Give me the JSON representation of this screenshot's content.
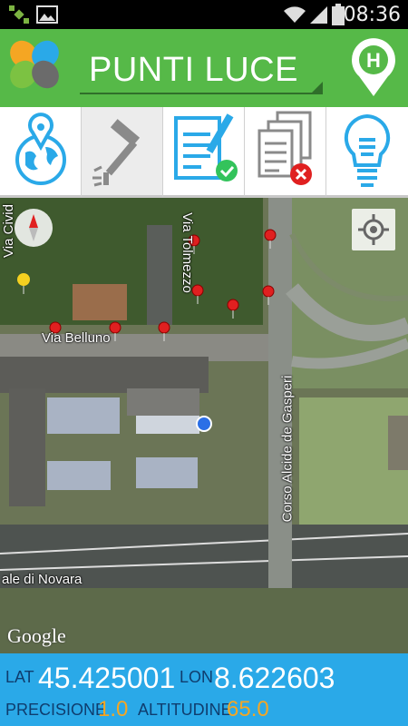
{
  "status_bar": {
    "time": "08:36"
  },
  "app_bar": {
    "title": "PUNTI LUCE"
  },
  "map": {
    "streets": {
      "via_civid": "Via Civid",
      "via_tolmezzo": "Via Tolmezzo",
      "via_belluno": "Via Belluno",
      "corso_gasperi": "Corso Alcide de Gasperi",
      "viale_novara": "ale di Novara"
    },
    "attribution": "Google"
  },
  "coordinates": {
    "lat_label": "LAT",
    "lat_value": "45.425001",
    "lon_label": "LON",
    "lon_value": "8.622603",
    "precision_label": "PRECISIONE",
    "precision_value": "1.0",
    "altitude_label": "ALTITUDINE",
    "altitude_value": "65.0"
  },
  "colors": {
    "app_bar": "#56b948",
    "coords_bar": "#2aa9e8",
    "accent_orange": "#f5a623",
    "marker_red": "#e02020"
  }
}
